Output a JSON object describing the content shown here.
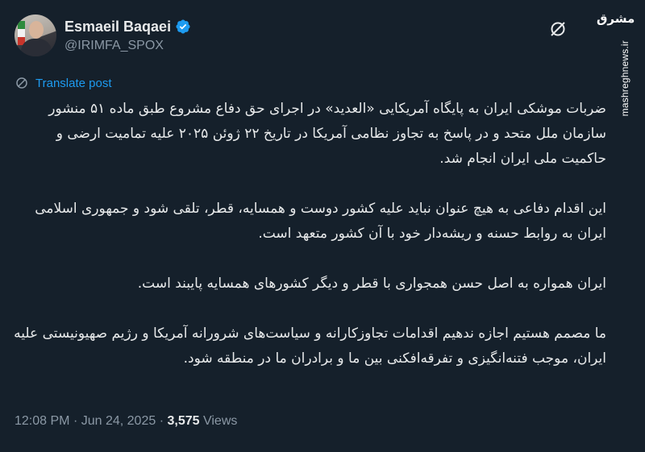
{
  "author": {
    "display_name": "Esmaeil Baqaei",
    "handle": "@IRIMFA_SPOX",
    "verified": true
  },
  "actions": {
    "translate_label": "Translate post"
  },
  "watermark": {
    "logo_text": "مشرق",
    "url": "mashreghnews.ir"
  },
  "tweet": {
    "paragraphs": [
      "ضربات موشکی ایران به پایگاه آمریکایی «العدید» در اجرای حق دفاع مشروع طبق ماده ۵۱ منشور سازمان ملل متحد و در پاسخ به تجاوز نظامی آمریکا در تاریخ ۲۲ ژوئن ۲۰۲۵ علیه تمامیت ارضی و حاکمیت ملی ایران انجام شد.",
      "این اقدام دفاعی به هیچ عنوان نباید علیه کشور دوست و همسایه، قطر، تلقی شود و جمهوری اسلامی ایران به روابط حسنه و ریشه‌دار خود با آن کشور متعهد است.",
      "ایران همواره به اصل حسن همجواری با قطر و دیگر کشورهای همسایه پایبند است.",
      "ما مصمم هستیم اجازه ندهیم اقدامات تجاوزکارانه و سیاست‌های شرورانه آمریکا و رژیم صهیونیستی علیه ایران، موجب فتنه‌انگیزی و تفرقه‌افکنی بین ما و برادران ما در منطقه شود."
    ]
  },
  "meta": {
    "time": "12:08 PM",
    "separator": "·",
    "date": "Jun 24, 2025",
    "views_count": "3,575",
    "views_label": "Views"
  },
  "colors": {
    "background": "#15202b",
    "text": "#e7e9ea",
    "secondary": "#8b98a5",
    "accent": "#1d9bf0"
  }
}
